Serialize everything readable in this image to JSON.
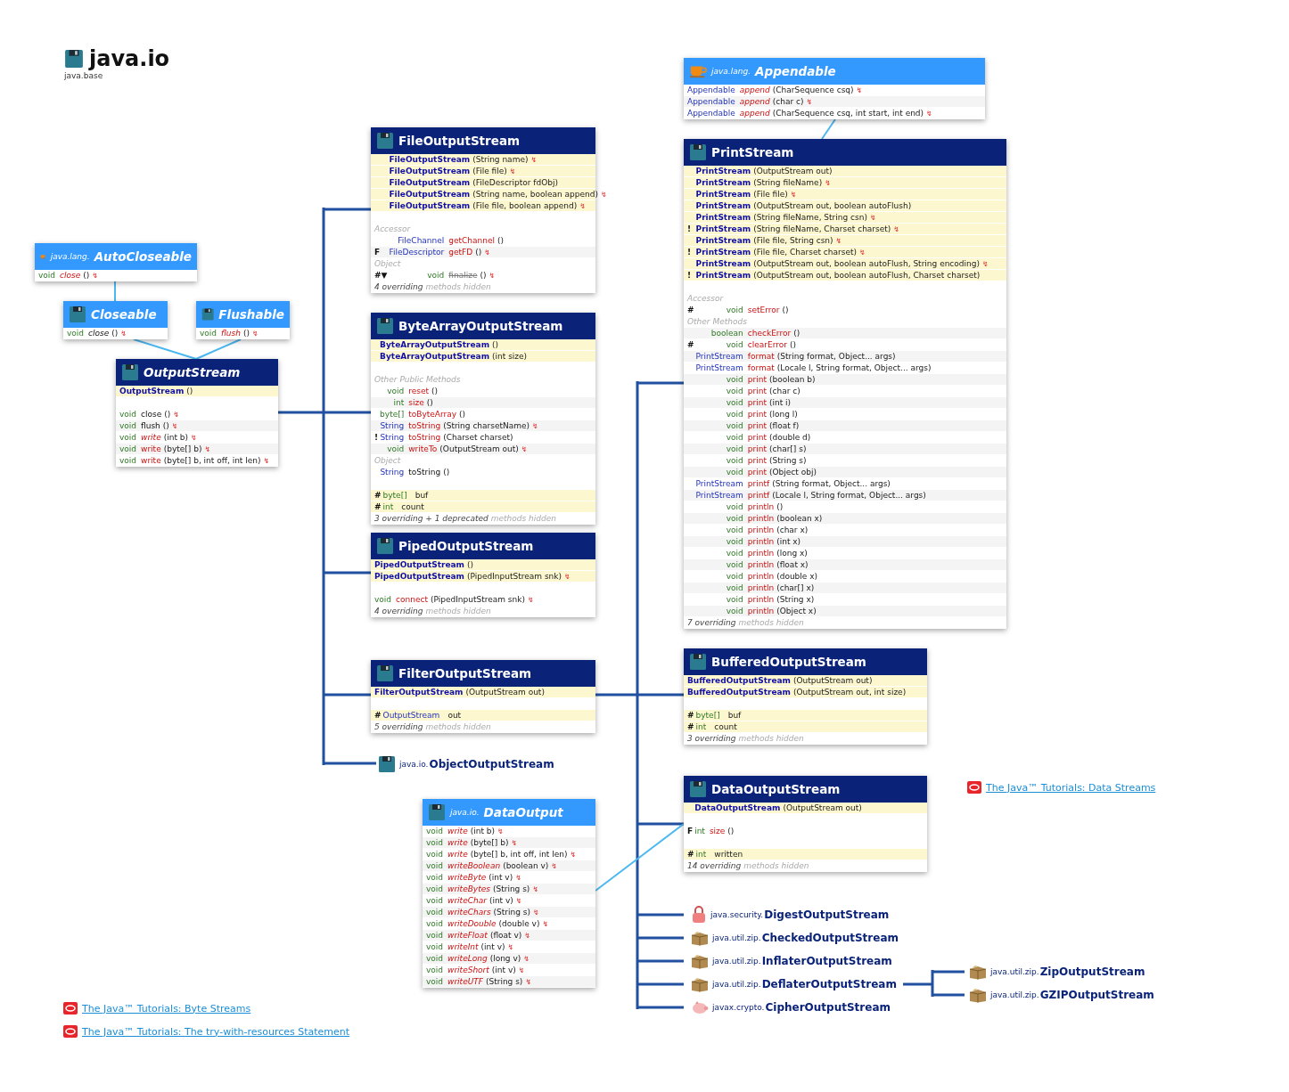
{
  "title": "java.io",
  "subtitle": "java.base",
  "types": [
    {
      "kind": "interface",
      "package": "java.lang.",
      "name": "AutoCloseable",
      "members": [
        {
          "kind": "method",
          "type": "void",
          "name": "close",
          "abstract": true,
          "params": "()",
          "throws": "↯"
        }
      ]
    },
    {
      "kind": "interface",
      "name": "Closeable",
      "members": [
        {
          "kind": "method",
          "type": "void",
          "name": "close",
          "abstract": true,
          "inherited": true,
          "params": "()",
          "throws": "↯"
        }
      ]
    },
    {
      "kind": "interface",
      "name": "Flushable",
      "members": [
        {
          "kind": "method",
          "type": "void",
          "name": "flush",
          "abstract": true,
          "params": "()",
          "throws": "↯"
        }
      ]
    },
    {
      "kind": "abstract",
      "name": "OutputStream",
      "members": [
        {
          "kind": "ctor",
          "name": "OutputStream",
          "params": "()"
        },
        {
          "kind": "method",
          "type": "void",
          "name": "close",
          "inherited": true,
          "params": "()",
          "throws": "↯"
        },
        {
          "kind": "method",
          "type": "void",
          "name": "flush",
          "inherited": true,
          "params": "()",
          "throws": "↯"
        },
        {
          "kind": "method",
          "type": "void",
          "name": "write",
          "abstract": true,
          "params": "(int b)",
          "throws": "↯"
        },
        {
          "kind": "method",
          "type": "void",
          "name": "write",
          "params": "(byte[] b)",
          "throws": "↯"
        },
        {
          "kind": "method",
          "type": "void",
          "name": "write",
          "params": "(byte[] b, int off, int len)",
          "throws": "↯"
        }
      ]
    },
    {
      "kind": "class",
      "name": "FileOutputStream",
      "members": [
        {
          "kind": "ctor",
          "name": "FileOutputStream",
          "params": "(String name)",
          "throws": "↯"
        },
        {
          "kind": "ctor",
          "name": "FileOutputStream",
          "params": "(File file)",
          "throws": "↯"
        },
        {
          "kind": "ctor",
          "name": "FileOutputStream",
          "params": "(FileDescriptor fdObj)"
        },
        {
          "kind": "ctor",
          "name": "FileOutputStream",
          "params": "(String name, boolean append)",
          "throws": "↯"
        },
        {
          "kind": "ctor",
          "name": "FileOutputStream",
          "params": "(File file, boolean append)",
          "throws": "↯"
        },
        {
          "kind": "section",
          "text": "Accessor"
        },
        {
          "kind": "method",
          "type": "FileChannel",
          "ref": true,
          "name": "getChannel",
          "params": "()"
        },
        {
          "kind": "method",
          "mod": "F",
          "type": "FileDescriptor",
          "ref": true,
          "name": "getFD",
          "params": "()",
          "throws": "↯"
        },
        {
          "kind": "section",
          "text": "Object"
        },
        {
          "kind": "method",
          "mod": "#▼",
          "type": "void",
          "name": "finalize",
          "deprecated": true,
          "params": "()",
          "throws": "↯"
        },
        {
          "kind": "note",
          "text": "4 overriding",
          "tail": "methods hidden"
        }
      ]
    },
    {
      "kind": "class",
      "name": "ByteArrayOutputStream",
      "members": [
        {
          "kind": "ctor",
          "name": "ByteArrayOutputStream",
          "params": "()"
        },
        {
          "kind": "ctor",
          "name": "ByteArrayOutputStream",
          "params": "(int size)"
        },
        {
          "kind": "section",
          "text": "Other Public Methods"
        },
        {
          "kind": "method",
          "type": "void",
          "name": "reset",
          "params": "()"
        },
        {
          "kind": "method",
          "type": "int",
          "name": "size",
          "params": "()"
        },
        {
          "kind": "method",
          "type": "byte[]",
          "name": "toByteArray",
          "params": "()"
        },
        {
          "kind": "method",
          "type": "String",
          "ref": true,
          "name": "toString",
          "params": "(String charsetName)",
          "throws": "↯"
        },
        {
          "kind": "method",
          "mod": "!",
          "type": "String",
          "ref": true,
          "name": "toString",
          "params": "(Charset charset)"
        },
        {
          "kind": "method",
          "type": "void",
          "name": "writeTo",
          "params": "(OutputStream out)",
          "throws": "↯"
        },
        {
          "kind": "section",
          "text": "Object"
        },
        {
          "kind": "method",
          "type": "String",
          "ref": true,
          "name": "toString",
          "inherited": true,
          "params": "()"
        },
        {
          "kind": "field",
          "mod": "#",
          "type": "byte[]",
          "name": "buf"
        },
        {
          "kind": "field",
          "mod": "#",
          "type": "int",
          "name": "count"
        },
        {
          "kind": "note",
          "text": "3 overriding + 1 deprecated",
          "tail": "methods hidden"
        }
      ]
    },
    {
      "kind": "class",
      "name": "PipedOutputStream",
      "members": [
        {
          "kind": "ctor",
          "name": "PipedOutputStream",
          "params": "()"
        },
        {
          "kind": "ctor",
          "name": "PipedOutputStream",
          "params": "(PipedInputStream snk)",
          "throws": "↯"
        },
        {
          "kind": "method",
          "type": "void",
          "name": "connect",
          "params": "(PipedInputStream snk)",
          "throws": "↯"
        },
        {
          "kind": "note",
          "text": "4 overriding",
          "tail": "methods hidden"
        }
      ]
    },
    {
      "kind": "class",
      "name": "FilterOutputStream",
      "members": [
        {
          "kind": "ctor",
          "name": "FilterOutputStream",
          "params": "(OutputStream out)"
        },
        {
          "kind": "field",
          "mod": "#",
          "type": "OutputStream",
          "ref": true,
          "name": "out"
        },
        {
          "kind": "note",
          "text": "5 overriding",
          "tail": "methods hidden"
        }
      ]
    },
    {
      "kind": "interface",
      "package": "java.io.",
      "name": "DataOutput",
      "members": [
        {
          "kind": "method",
          "type": "void",
          "name": "write",
          "abstract": true,
          "params": "(int b)",
          "throws": "↯"
        },
        {
          "kind": "method",
          "type": "void",
          "name": "write",
          "abstract": true,
          "params": "(byte[] b)",
          "throws": "↯"
        },
        {
          "kind": "method",
          "type": "void",
          "name": "write",
          "abstract": true,
          "params": "(byte[] b, int off, int len)",
          "throws": "↯"
        },
        {
          "kind": "method",
          "type": "void",
          "name": "writeBoolean",
          "abstract": true,
          "params": "(boolean v)",
          "throws": "↯"
        },
        {
          "kind": "method",
          "type": "void",
          "name": "writeByte",
          "abstract": true,
          "params": "(int v)",
          "throws": "↯"
        },
        {
          "kind": "method",
          "type": "void",
          "name": "writeBytes",
          "abstract": true,
          "params": "(String s)",
          "throws": "↯"
        },
        {
          "kind": "method",
          "type": "void",
          "name": "writeChar",
          "abstract": true,
          "params": "(int v)",
          "throws": "↯"
        },
        {
          "kind": "method",
          "type": "void",
          "name": "writeChars",
          "abstract": true,
          "params": "(String s)",
          "throws": "↯"
        },
        {
          "kind": "method",
          "type": "void",
          "name": "writeDouble",
          "abstract": true,
          "params": "(double v)",
          "throws": "↯"
        },
        {
          "kind": "method",
          "type": "void",
          "name": "writeFloat",
          "abstract": true,
          "params": "(float v)",
          "throws": "↯"
        },
        {
          "kind": "method",
          "type": "void",
          "name": "writeInt",
          "abstract": true,
          "params": "(int v)",
          "throws": "↯"
        },
        {
          "kind": "method",
          "type": "void",
          "name": "writeLong",
          "abstract": true,
          "params": "(long v)",
          "throws": "↯"
        },
        {
          "kind": "method",
          "type": "void",
          "name": "writeShort",
          "abstract": true,
          "params": "(int v)",
          "throws": "↯"
        },
        {
          "kind": "method",
          "type": "void",
          "name": "writeUTF",
          "abstract": true,
          "params": "(String s)",
          "throws": "↯"
        }
      ]
    },
    {
      "kind": "interface",
      "package": "java.lang.",
      "name": "Appendable",
      "members": [
        {
          "kind": "method",
          "type": "Appendable",
          "ref": true,
          "name": "append",
          "abstract": true,
          "params": "(CharSequence csq)",
          "throws": "↯"
        },
        {
          "kind": "method",
          "type": "Appendable",
          "ref": true,
          "name": "append",
          "abstract": true,
          "params": "(char c)",
          "throws": "↯"
        },
        {
          "kind": "method",
          "type": "Appendable",
          "ref": true,
          "name": "append",
          "abstract": true,
          "params": "(CharSequence csq, int start, int end)",
          "throws": "↯"
        }
      ]
    },
    {
      "kind": "class",
      "name": "PrintStream",
      "members": [
        {
          "kind": "ctor",
          "name": "PrintStream",
          "params": "(OutputStream out)"
        },
        {
          "kind": "ctor",
          "name": "PrintStream",
          "params": "(String fileName)",
          "throws": "↯"
        },
        {
          "kind": "ctor",
          "name": "PrintStream",
          "params": "(File file)",
          "throws": "↯"
        },
        {
          "kind": "ctor",
          "name": "PrintStream",
          "params": "(OutputStream out, boolean autoFlush)"
        },
        {
          "kind": "ctor",
          "name": "PrintStream",
          "params": "(String fileName, String csn)",
          "throws": "↯"
        },
        {
          "kind": "ctor",
          "mod": "!",
          "name": "PrintStream",
          "params": "(String fileName, Charset charset)",
          "throws": "↯"
        },
        {
          "kind": "ctor",
          "name": "PrintStream",
          "params": "(File file, String csn)",
          "throws": "↯"
        },
        {
          "kind": "ctor",
          "mod": "!",
          "name": "PrintStream",
          "params": "(File file, Charset charset)",
          "throws": "↯"
        },
        {
          "kind": "ctor",
          "name": "PrintStream",
          "params": "(OutputStream out, boolean autoFlush, String encoding)",
          "throws": "↯"
        },
        {
          "kind": "ctor",
          "mod": "!",
          "name": "PrintStream",
          "params": "(OutputStream out, boolean autoFlush, Charset charset)"
        },
        {
          "kind": "section",
          "text": "Accessor"
        },
        {
          "kind": "method",
          "mod": "#",
          "type": "void",
          "name": "setError",
          "params": "()"
        },
        {
          "kind": "section",
          "text": "Other Methods"
        },
        {
          "kind": "method",
          "type": "boolean",
          "name": "checkError",
          "params": "()"
        },
        {
          "kind": "method",
          "mod": "#",
          "type": "void",
          "name": "clearError",
          "params": "()"
        },
        {
          "kind": "method",
          "type": "PrintStream",
          "ref": true,
          "name": "format",
          "params": "(String format, Object... args)"
        },
        {
          "kind": "method",
          "type": "PrintStream",
          "ref": true,
          "name": "format",
          "params": "(Locale l, String format, Object... args)"
        },
        {
          "kind": "method",
          "type": "void",
          "name": "print",
          "params": "(boolean b)"
        },
        {
          "kind": "method",
          "type": "void",
          "name": "print",
          "params": "(char c)"
        },
        {
          "kind": "method",
          "type": "void",
          "name": "print",
          "params": "(int i)"
        },
        {
          "kind": "method",
          "type": "void",
          "name": "print",
          "params": "(long l)"
        },
        {
          "kind": "method",
          "type": "void",
          "name": "print",
          "params": "(float f)"
        },
        {
          "kind": "method",
          "type": "void",
          "name": "print",
          "params": "(double d)"
        },
        {
          "kind": "method",
          "type": "void",
          "name": "print",
          "params": "(char[] s)"
        },
        {
          "kind": "method",
          "type": "void",
          "name": "print",
          "params": "(String s)"
        },
        {
          "kind": "method",
          "type": "void",
          "name": "print",
          "params": "(Object obj)"
        },
        {
          "kind": "method",
          "type": "PrintStream",
          "ref": true,
          "name": "printf",
          "params": "(String format, Object... args)"
        },
        {
          "kind": "method",
          "type": "PrintStream",
          "ref": true,
          "name": "printf",
          "params": "(Locale l, String format, Object... args)"
        },
        {
          "kind": "method",
          "type": "void",
          "name": "println",
          "params": "()"
        },
        {
          "kind": "method",
          "type": "void",
          "name": "println",
          "params": "(boolean x)"
        },
        {
          "kind": "method",
          "type": "void",
          "name": "println",
          "params": "(char x)"
        },
        {
          "kind": "method",
          "type": "void",
          "name": "println",
          "params": "(int x)"
        },
        {
          "kind": "method",
          "type": "void",
          "name": "println",
          "params": "(long x)"
        },
        {
          "kind": "method",
          "type": "void",
          "name": "println",
          "params": "(float x)"
        },
        {
          "kind": "method",
          "type": "void",
          "name": "println",
          "params": "(double x)"
        },
        {
          "kind": "method",
          "type": "void",
          "name": "println",
          "params": "(char[] x)"
        },
        {
          "kind": "method",
          "type": "void",
          "name": "println",
          "params": "(String x)"
        },
        {
          "kind": "method",
          "type": "void",
          "name": "println",
          "params": "(Object x)"
        },
        {
          "kind": "note",
          "text": "7 overriding",
          "tail": "methods hidden"
        }
      ]
    },
    {
      "kind": "class",
      "name": "BufferedOutputStream",
      "members": [
        {
          "kind": "ctor",
          "name": "BufferedOutputStream",
          "params": "(OutputStream out)"
        },
        {
          "kind": "ctor",
          "name": "BufferedOutputStream",
          "params": "(OutputStream out, int size)"
        },
        {
          "kind": "field",
          "mod": "#",
          "type": "byte[]",
          "name": "buf"
        },
        {
          "kind": "field",
          "mod": "#",
          "type": "int",
          "name": "count"
        },
        {
          "kind": "note",
          "text": "3 overriding",
          "tail": "methods hidden"
        }
      ]
    },
    {
      "kind": "class",
      "name": "DataOutputStream",
      "members": [
        {
          "kind": "ctor",
          "name": "DataOutputStream",
          "params": "(OutputStream out)"
        },
        {
          "kind": "method",
          "mod": "F",
          "type": "int",
          "name": "size",
          "params": "()"
        },
        {
          "kind": "field",
          "mod": "#",
          "type": "int",
          "name": "written"
        },
        {
          "kind": "note",
          "text": "14 overriding",
          "tail": "methods hidden"
        }
      ]
    }
  ],
  "nodes": [
    {
      "package": "java.io.",
      "name": "ObjectOutputStream"
    },
    {
      "package": "java.security.",
      "name": "DigestOutputStream"
    },
    {
      "package": "java.util.zip.",
      "name": "CheckedOutputStream"
    },
    {
      "package": "java.util.zip.",
      "name": "InflaterOutputStream"
    },
    {
      "package": "java.util.zip.",
      "name": "DeflaterOutputStream"
    },
    {
      "package": "javax.crypto.",
      "name": "CipherOutputStream"
    },
    {
      "package": "java.util.zip.",
      "name": "ZipOutputStream"
    },
    {
      "package": "java.util.zip.",
      "name": "GZIPOutputStream"
    }
  ],
  "links": [
    "The Java™ Tutorials: Data Streams",
    "The Java™ Tutorials: Byte Streams",
    "The Java™ Tutorials: The try-with-resources Statement"
  ]
}
